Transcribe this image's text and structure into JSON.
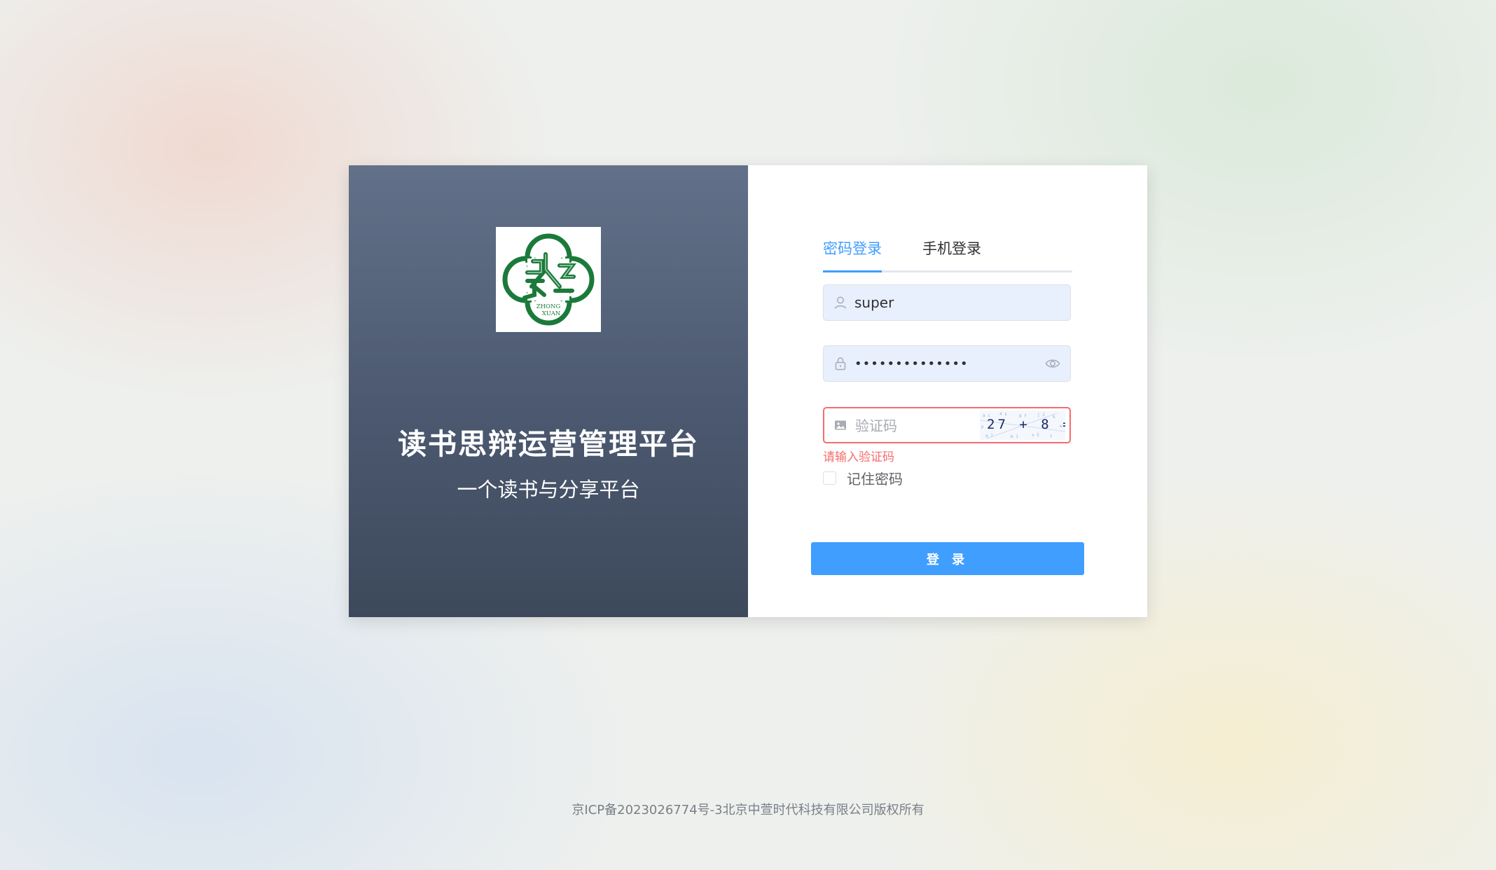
{
  "brand": {
    "logo_icon": "zhongxuan-logo-icon",
    "logo_text_line1": "ZHONG",
    "logo_text_line2": "XUAN",
    "title": "读书思辩运营管理平台",
    "subtitle": "一个读书与分享平台"
  },
  "tabs": [
    {
      "label": "密码登录",
      "active": true
    },
    {
      "label": "手机登录",
      "active": false
    }
  ],
  "form": {
    "username": {
      "value": "super",
      "icon": "user-icon"
    },
    "password": {
      "value": "superpassword1",
      "icon": "lock-icon",
      "toggle_icon": "eye-icon"
    },
    "captcha": {
      "value": "",
      "placeholder": "验证码",
      "icon": "image-icon",
      "image_text": "27 + 8 ="
    },
    "error": "请输入验证码",
    "remember_label": "记住密码",
    "remember_checked": false,
    "submit_label": "登 录"
  },
  "colors": {
    "accent": "#409eff",
    "error": "#f56c6c",
    "brand_panel_top": "#627189",
    "brand_panel_bottom": "#3d495b",
    "logo_green": "#1b7a3a"
  },
  "footer": {
    "copyright": "京ICP备2023026774号-3北京中萱时代科技有限公司版权所有"
  }
}
